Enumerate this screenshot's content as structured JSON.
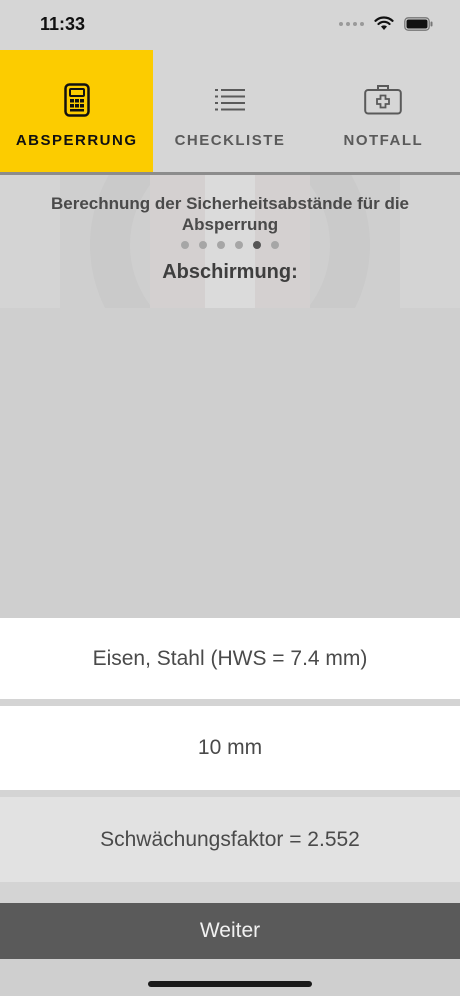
{
  "statusbar": {
    "time": "11:33"
  },
  "tabs": [
    {
      "label": "ABSPERRUNG",
      "icon": "calculator-icon",
      "active": true
    },
    {
      "label": "CHECKLISTE",
      "icon": "list-icon",
      "active": false
    },
    {
      "label": "NOTFALL",
      "icon": "first-aid-kit-icon",
      "active": false
    }
  ],
  "hero": {
    "description": "Berechnung der Sicherheitsabstände für die Absperrung",
    "page_indicator": {
      "count": 6,
      "active_index": 4
    },
    "section_title": "Abschirmung:"
  },
  "fields": {
    "material": "Eisen, Stahl (HWS = 7.4 mm)",
    "thickness": "10 mm",
    "factor": "Schwächungsfaktor = 2.552"
  },
  "button": {
    "label": "Weiter"
  },
  "colors": {
    "accent": "#fccc00",
    "button": "#5a5a5a",
    "background": "#d4d4d4"
  }
}
